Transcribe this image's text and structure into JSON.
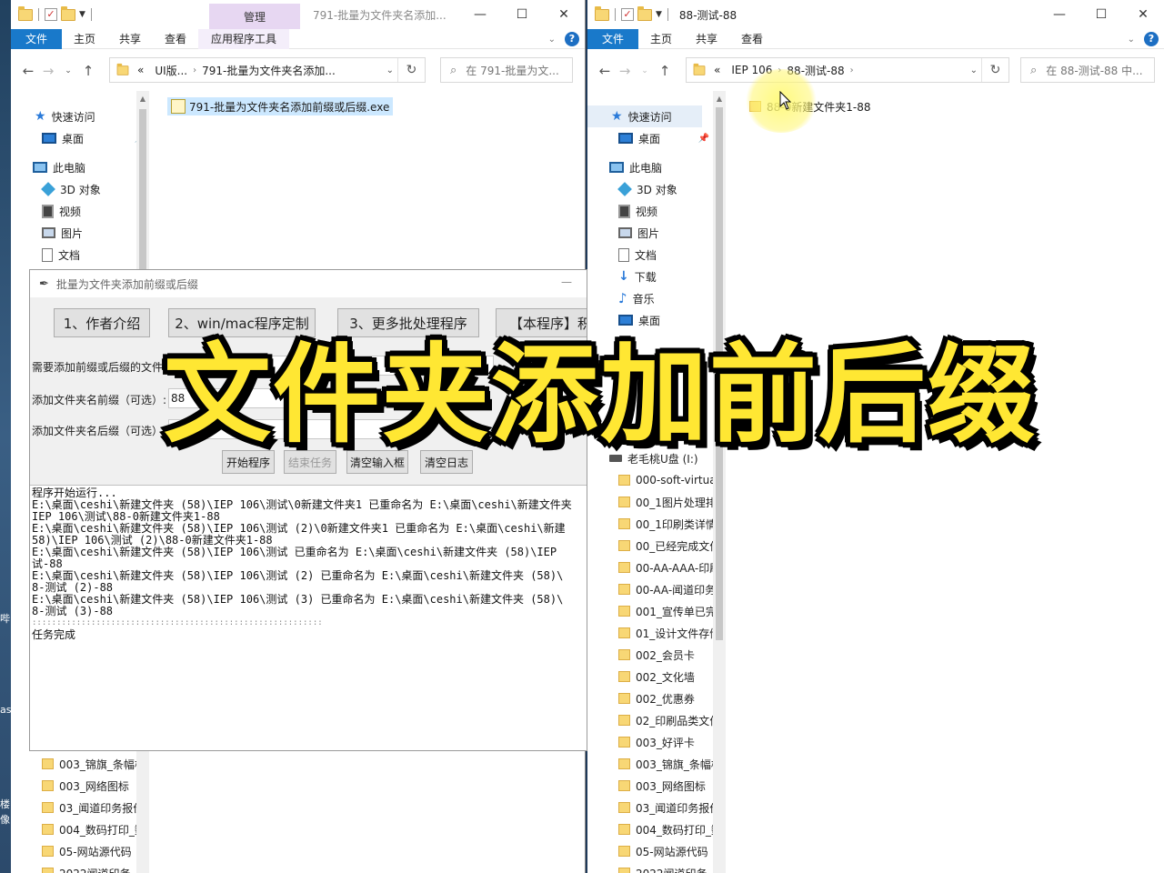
{
  "desktop": {
    "side_texts": [
      "哔",
      "as",
      "楼",
      "像"
    ]
  },
  "left_window": {
    "title": "791-批量为文件夹名添加...",
    "manage_tab": "管理",
    "ribbon_tabs": [
      "文件",
      "主页",
      "共享",
      "查看",
      "应用程序工具"
    ],
    "breadcrumb": [
      "UI版...",
      "791-批量为文件夹名添加..."
    ],
    "search_placeholder": "在 791-批量为文...",
    "nav_top": [
      {
        "label": "快速访问",
        "icon": "star-icon"
      },
      {
        "label": "桌面",
        "icon": "desktop-icon",
        "pinned": true
      },
      {
        "label": "此电脑",
        "icon": "computer-icon"
      },
      {
        "label": "3D 对象",
        "icon": "cube-icon"
      },
      {
        "label": "视频",
        "icon": "video-icon"
      },
      {
        "label": "图片",
        "icon": "picture-icon"
      },
      {
        "label": "文档",
        "icon": "document-icon"
      }
    ],
    "nav_bottom": [
      "003_锦旗_条幅样",
      "003_网络图标",
      "03_闻道印务报价",
      "004_数码打印_数",
      "05-网站源代码",
      "2022闻道印务"
    ],
    "file": "791-批量为文件夹名添加前缀或后缀.exe"
  },
  "right_window": {
    "title": "88-测试-88",
    "ribbon_tabs": [
      "文件",
      "主页",
      "共享",
      "查看"
    ],
    "breadcrumb": [
      "IEP 106",
      "88-测试-88"
    ],
    "search_placeholder": "在 88-测试-88 中...",
    "nav_top": [
      {
        "label": "快速访问",
        "icon": "star-icon"
      },
      {
        "label": "桌面",
        "icon": "desktop-icon",
        "pinned": true
      },
      {
        "label": "此电脑",
        "icon": "computer-icon"
      },
      {
        "label": "3D 对象",
        "icon": "cube-icon"
      },
      {
        "label": "视频",
        "icon": "video-icon"
      },
      {
        "label": "图片",
        "icon": "picture-icon"
      },
      {
        "label": "文档",
        "icon": "document-icon"
      },
      {
        "label": "下载",
        "icon": "download-icon"
      },
      {
        "label": "音乐",
        "icon": "music-icon"
      },
      {
        "label": "桌面",
        "icon": "desktop-icon"
      }
    ],
    "drive": "老毛桃U盘 (I:)",
    "folders": [
      "000-soft-virtual",
      "00_1图片处理排",
      "00_1印刷类详情",
      "00_已经完成文件",
      "00-AA-AAA-印刷",
      "00-AA-闻道印务",
      "001_宣传单已完",
      "01_设计文件存储",
      "002_会员卡",
      "002_文化墙",
      "002_优惠券",
      "02_印刷品类文件",
      "003_好评卡",
      "003_锦旗_条幅样",
      "003_网络图标",
      "03_闻道印务报价",
      "004_数码打印_数",
      "05-网站源代码",
      "2022闻道印务"
    ],
    "file": "88-0新建文件夹1-88"
  },
  "tool": {
    "title": "批量为文件夹添加前缀或后缀",
    "top_buttons": [
      "1、作者介绍",
      "2、win/mac程序定制",
      "3、更多批处理程序",
      "【本程序】积"
    ],
    "label_path": "需要添加前缀或后缀的文件夹所在的目录",
    "label_prefix": "添加文件夹名前缀（可选）:",
    "prefix_value": "88",
    "label_suffix": "添加文件夹名后缀（可选）:",
    "actions": [
      "开始程序",
      "结束任务",
      "清空输入框",
      "清空日志"
    ],
    "log": [
      "程序开始运行...",
      "E:\\桌面\\ceshi\\新建文件夹 (58)\\IEP 106\\测试\\0新建文件夹1 已重命名为 E:\\桌面\\ceshi\\新建文件夹",
      "IEP 106\\测试\\88-0新建文件夹1-88",
      "E:\\桌面\\ceshi\\新建文件夹 (58)\\IEP 106\\测试 (2)\\0新建文件夹1 已重命名为 E:\\桌面\\ceshi\\新建",
      "58)\\IEP 106\\测试 (2)\\88-0新建文件夹1-88",
      "E:\\桌面\\ceshi\\新建文件夹 (58)\\IEP 106\\测试 已重命名为 E:\\桌面\\ceshi\\新建文件夹 (58)\\IEP",
      "试-88",
      "E:\\桌面\\ceshi\\新建文件夹 (58)\\IEP 106\\测试 (2) 已重命名为 E:\\桌面\\ceshi\\新建文件夹 (58)\\",
      "8-测试 (2)-88",
      "E:\\桌面\\ceshi\\新建文件夹 (58)\\IEP 106\\测试 (3) 已重命名为 E:\\桌面\\ceshi\\新建文件夹 (58)\\",
      "8-测试 (3)-88",
      ":::::::::::::::::::::::::::::::::::::::::::::::::::::::::::",
      "任务完成"
    ]
  },
  "overlay_caption": "文件夹添加前后缀"
}
